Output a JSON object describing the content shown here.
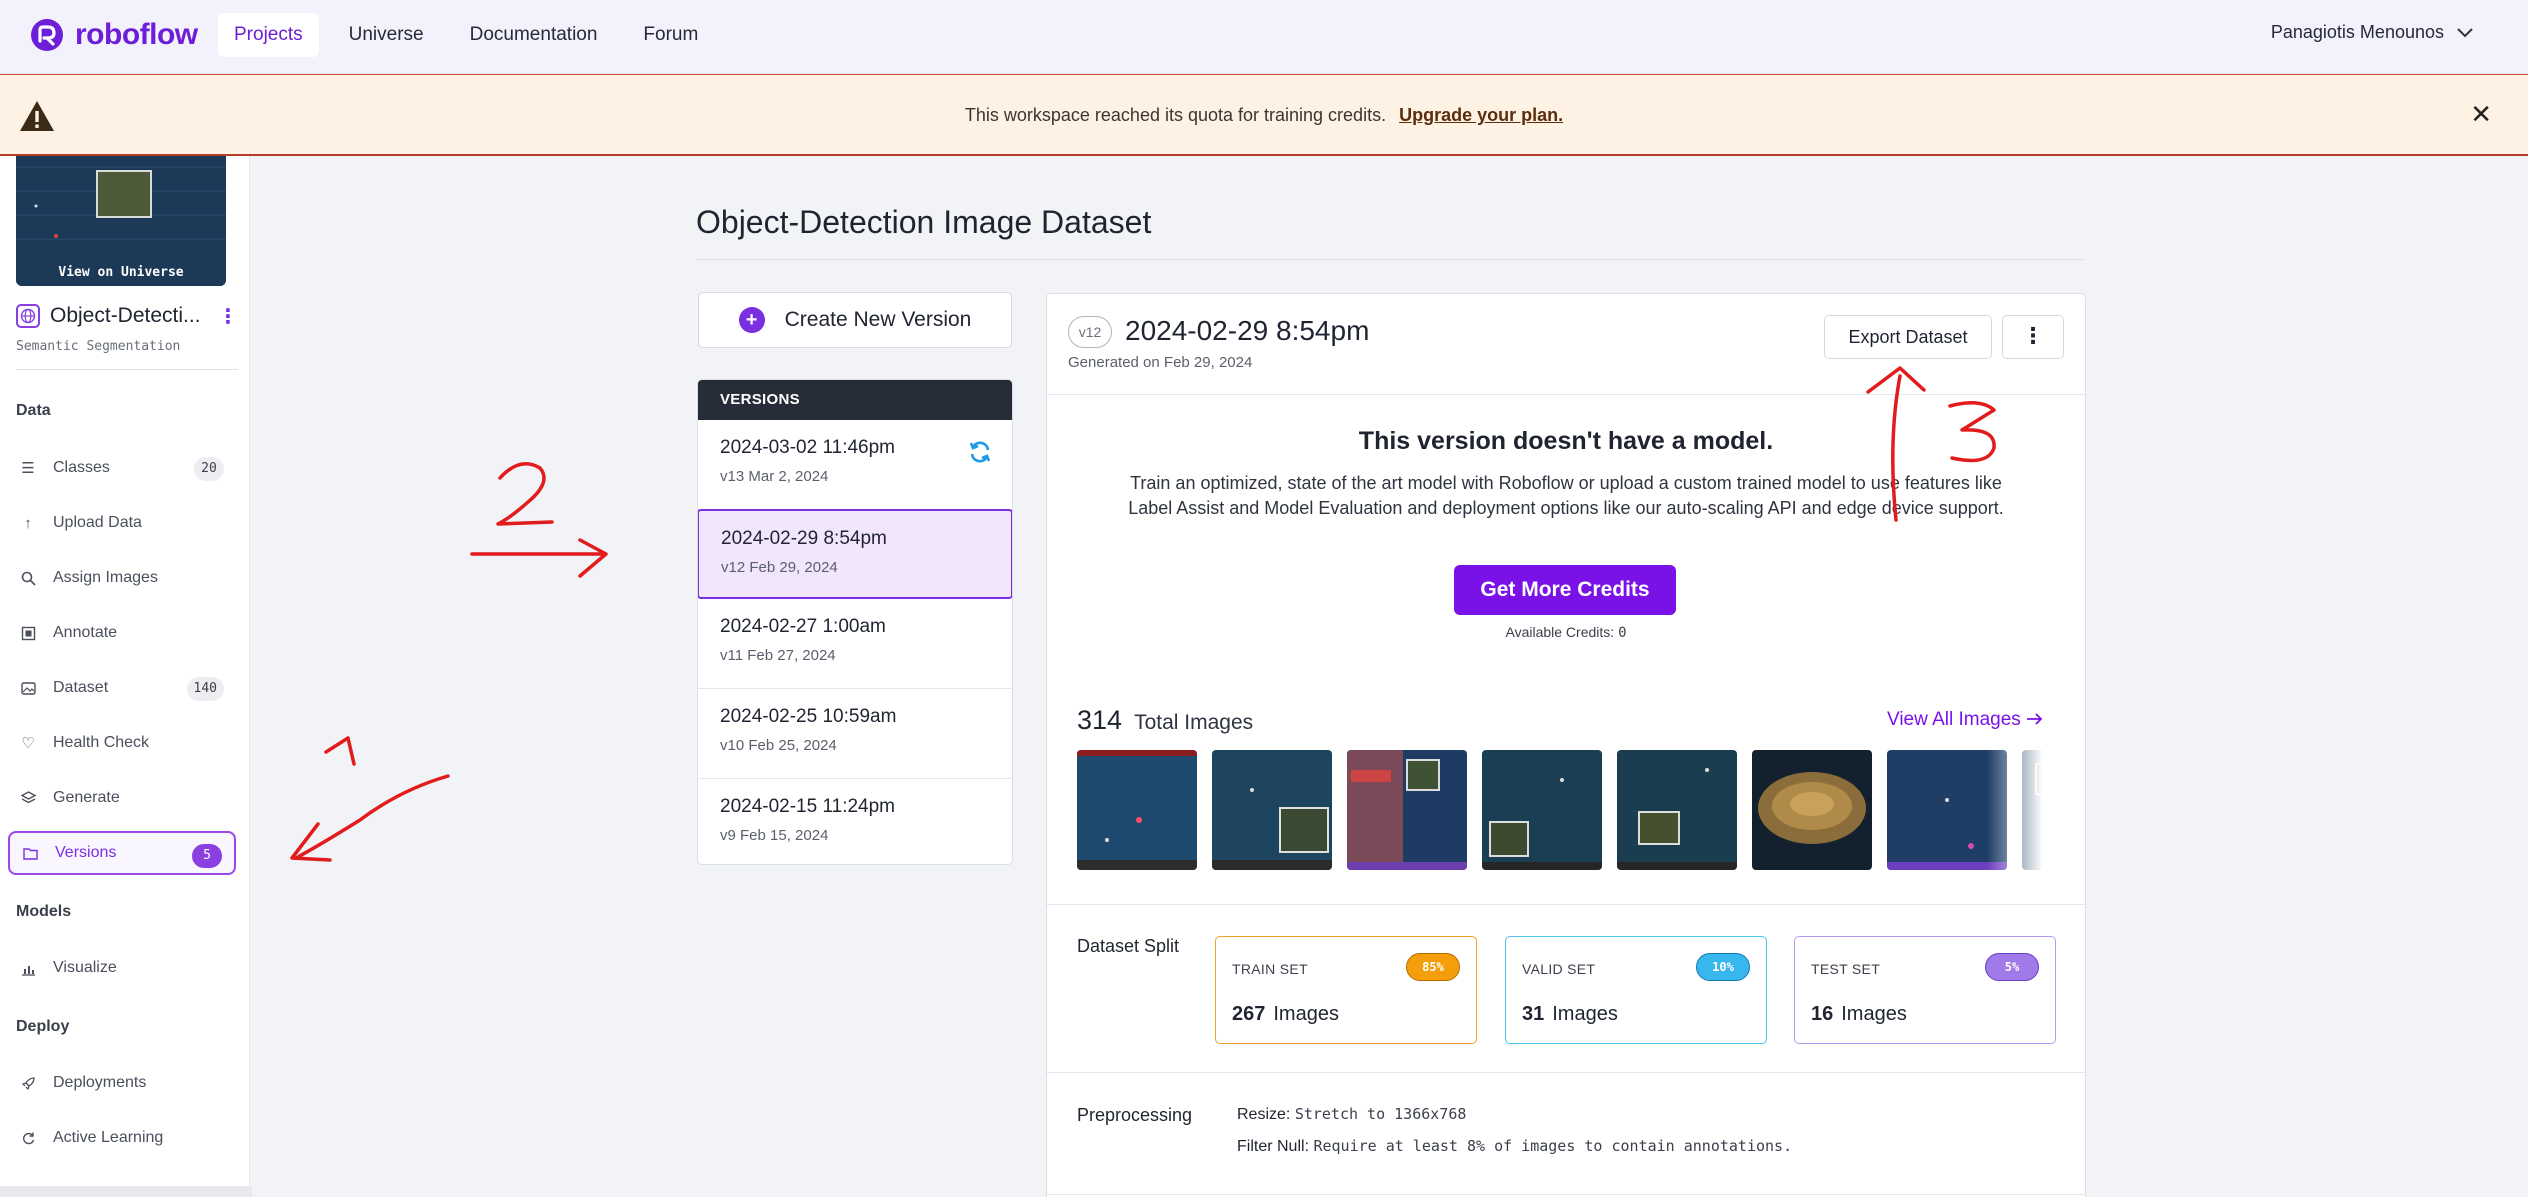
{
  "brand": {
    "name": "roboflow",
    "color": "#6c1fd6"
  },
  "nav": {
    "links": [
      "Projects",
      "Universe",
      "Documentation",
      "Forum"
    ],
    "active": "Projects",
    "user": "Panagiotis Menounos"
  },
  "banner": {
    "message": "This workspace reached its quota for training credits.",
    "link": "Upgrade your plan.",
    "close": "✕"
  },
  "sidebar": {
    "view_label": "View on Universe",
    "project_name": "Object-Detecti...",
    "project_type": "Semantic Segmentation",
    "sections": {
      "data": "Data",
      "models": "Models",
      "deploy": "Deploy"
    },
    "items": [
      {
        "label": "Classes",
        "badge": "20",
        "icon": "list-icon"
      },
      {
        "label": "Upload Data",
        "badge": "",
        "icon": "upload-icon"
      },
      {
        "label": "Assign Images",
        "badge": "",
        "icon": "search-icon"
      },
      {
        "label": "Annotate",
        "badge": "",
        "icon": "annotate-icon"
      },
      {
        "label": "Dataset",
        "badge": "140",
        "icon": "images-icon"
      },
      {
        "label": "Health Check",
        "badge": "",
        "icon": "heart-icon"
      },
      {
        "label": "Generate",
        "badge": "",
        "icon": "layers-icon"
      },
      {
        "label": "Versions",
        "badge": "5",
        "icon": "folder-icon",
        "active": true
      }
    ],
    "models_items": [
      {
        "label": "Visualize",
        "icon": "chart-icon"
      }
    ],
    "deploy_items": [
      {
        "label": "Deployments",
        "icon": "rocket-icon"
      },
      {
        "label": "Active Learning",
        "icon": "loop-icon"
      }
    ]
  },
  "main": {
    "title": "Object-Detection Image Dataset",
    "create_version": "Create New Version",
    "versions_header": "VERSIONS",
    "versions": [
      {
        "date": "2024-03-02 11:46pm",
        "sub": "v13 Mar 2, 2024",
        "syncing": true
      },
      {
        "date": "2024-02-29 8:54pm",
        "sub": "v12 Feb 29, 2024",
        "selected": true
      },
      {
        "date": "2024-02-27 1:00am",
        "sub": "v11 Feb 27, 2024"
      },
      {
        "date": "2024-02-25 10:59am",
        "sub": "v10 Feb 25, 2024"
      },
      {
        "date": "2024-02-15 11:24pm",
        "sub": "v9 Feb 15, 2024"
      }
    ],
    "detail": {
      "version_badge": "v12",
      "version_title": "2024-02-29 8:54pm",
      "generated": "Generated on Feb 29, 2024",
      "export_label": "Export Dataset",
      "more_label": "⋮",
      "no_model_title": "This version doesn't have a model.",
      "no_model_desc": "Train an optimized, state of the art model with Roboflow or upload a custom trained model to use features like Label Assist and Model Evaluation and deployment options like our auto-scaling API and edge device support.",
      "credits_button": "Get More Credits",
      "credits_label": "Available Credits:",
      "credits_value": "0",
      "total_images": "314",
      "total_label": "Total Images",
      "view_all": "View All Images",
      "split_label": "Dataset Split",
      "splits": [
        {
          "name": "TRAIN SET",
          "pct": "85%",
          "count": "267",
          "unit": "Images",
          "color": "#f0a32a",
          "pill_bg": "#f59e0b"
        },
        {
          "name": "VALID SET",
          "pct": "10%",
          "count": "31",
          "unit": "Images",
          "color": "#4fc3f0",
          "pill_bg": "#38b6ee"
        },
        {
          "name": "TEST SET",
          "pct": "5%",
          "count": "16",
          "unit": "Images",
          "color": "#b79af0",
          "pill_bg": "#a07ae8"
        }
      ],
      "preprocessing_label": "Preprocessing",
      "preprocessing": [
        {
          "key": "Resize:",
          "value": "Stretch to 1366x768"
        },
        {
          "key": "Filter Null:",
          "value": "Require at least 8% of images to contain annotations."
        }
      ]
    }
  },
  "annotations": [
    "1",
    "2",
    "3"
  ]
}
